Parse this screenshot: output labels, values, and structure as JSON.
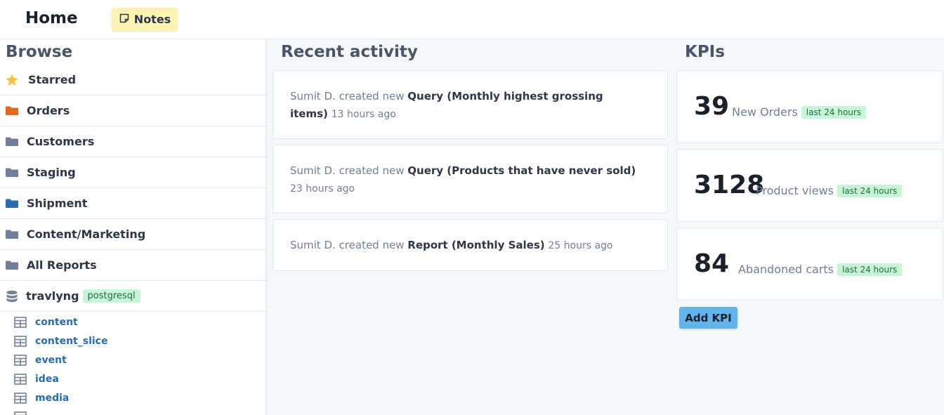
{
  "header": {
    "title": "Home",
    "notes_label": "Notes"
  },
  "sidebar": {
    "title": "Browse",
    "items": [
      {
        "label": "Starred",
        "icon": "star-icon",
        "color": "#f6c343"
      },
      {
        "label": "Orders",
        "icon": "folder-icon",
        "color": "#dd6b20"
      },
      {
        "label": "Customers",
        "icon": "folder-icon",
        "color": "#718096"
      },
      {
        "label": "Staging",
        "icon": "folder-icon",
        "color": "#718096"
      },
      {
        "label": "Shipment",
        "icon": "folder-icon",
        "color": "#2b6cb0"
      },
      {
        "label": "Content/Marketing",
        "icon": "folder-icon",
        "color": "#718096"
      },
      {
        "label": "All Reports",
        "icon": "folder-icon",
        "color": "#718096"
      }
    ],
    "database": {
      "name": "travlyng",
      "badge": "postgresql",
      "icon": "database-icon"
    },
    "tables": [
      {
        "label": "content"
      },
      {
        "label": "content_slice"
      },
      {
        "label": "event"
      },
      {
        "label": "idea"
      },
      {
        "label": "media"
      }
    ]
  },
  "activity": {
    "title": "Recent activity",
    "items": [
      {
        "actor": "Sumit D.",
        "verb": "created new",
        "object": "Query (Monthly highest grossing items)",
        "when": "13 hours ago"
      },
      {
        "actor": "Sumit D.",
        "verb": "created new",
        "object": "Query (Products that have never sold)",
        "when": "23 hours ago"
      },
      {
        "actor": "Sumit D.",
        "verb": "created new",
        "object": "Report (Monthly Sales)",
        "when": "25 hours ago"
      }
    ]
  },
  "kpis": {
    "title": "KPIs",
    "items": [
      {
        "value": "39",
        "label": "New Orders",
        "badge": "last 24 hours"
      },
      {
        "value": "3128",
        "label": "Product views",
        "badge": "last 24 hours"
      },
      {
        "value": "84",
        "label": "Abandoned carts",
        "badge": "last 24 hours"
      }
    ],
    "add_label": "Add KPI"
  }
}
